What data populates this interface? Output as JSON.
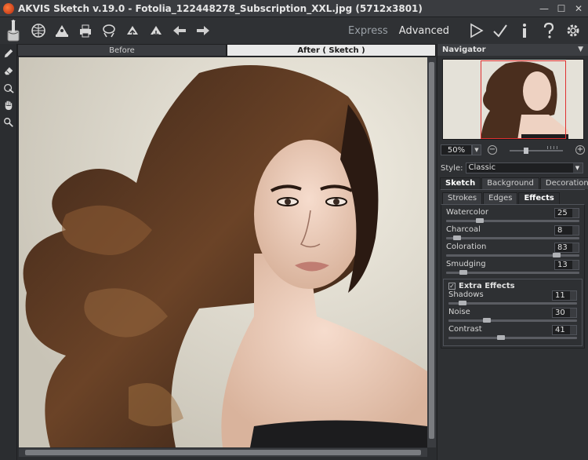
{
  "window": {
    "title": "AKVIS Sketch v.19.0 - Fotolia_122448278_Subscription_XXL.jpg (5712x3801)"
  },
  "toolbar": {
    "icons": [
      "open-image-icon",
      "save-image-icon",
      "print-icon",
      "share-icon",
      "load-preset-icon",
      "save-preset-icon",
      "undo-icon",
      "redo-icon"
    ],
    "modes": {
      "express": "Express",
      "advanced": "Advanced"
    },
    "right_icons": [
      "run-icon",
      "apply-icon",
      "info-icon",
      "help-icon",
      "settings-icon"
    ]
  },
  "tools": [
    "pencil-icon",
    "eraser-icon",
    "brush-icon",
    "hand-icon",
    "zoom-icon"
  ],
  "canvas": {
    "tabs": {
      "before": "Before",
      "after": "After ( Sketch )"
    },
    "active_tab": "after"
  },
  "navigator": {
    "title": "Navigator",
    "zoom": "50%",
    "zoom_out_icon": "minus-icon",
    "zoom_in_icon": "plus-icon"
  },
  "style": {
    "label": "Style:",
    "value": "Classic"
  },
  "main_tabs": [
    "Sketch",
    "Background",
    "Decoration"
  ],
  "sub_tabs": [
    "Strokes",
    "Edges",
    "Effects"
  ],
  "params": [
    {
      "label": "Watercolor",
      "value": "25",
      "level": 0.25
    },
    {
      "label": "Charcoal",
      "value": "8",
      "level": 0.08
    },
    {
      "label": "Coloration",
      "value": "83",
      "level": 0.83
    },
    {
      "label": "Smudging",
      "value": "13",
      "level": 0.13
    }
  ],
  "extra_effects": {
    "title": "Extra Effects",
    "checked": true,
    "params": [
      {
        "label": "Shadows",
        "value": "11",
        "level": 0.11
      },
      {
        "label": "Noise",
        "value": "30",
        "level": 0.3
      },
      {
        "label": "Contrast",
        "value": "41",
        "level": 0.41
      }
    ]
  },
  "colors": {
    "accent": "#e03030",
    "panel": "#2e3033",
    "toolbar": "#2f3134"
  }
}
